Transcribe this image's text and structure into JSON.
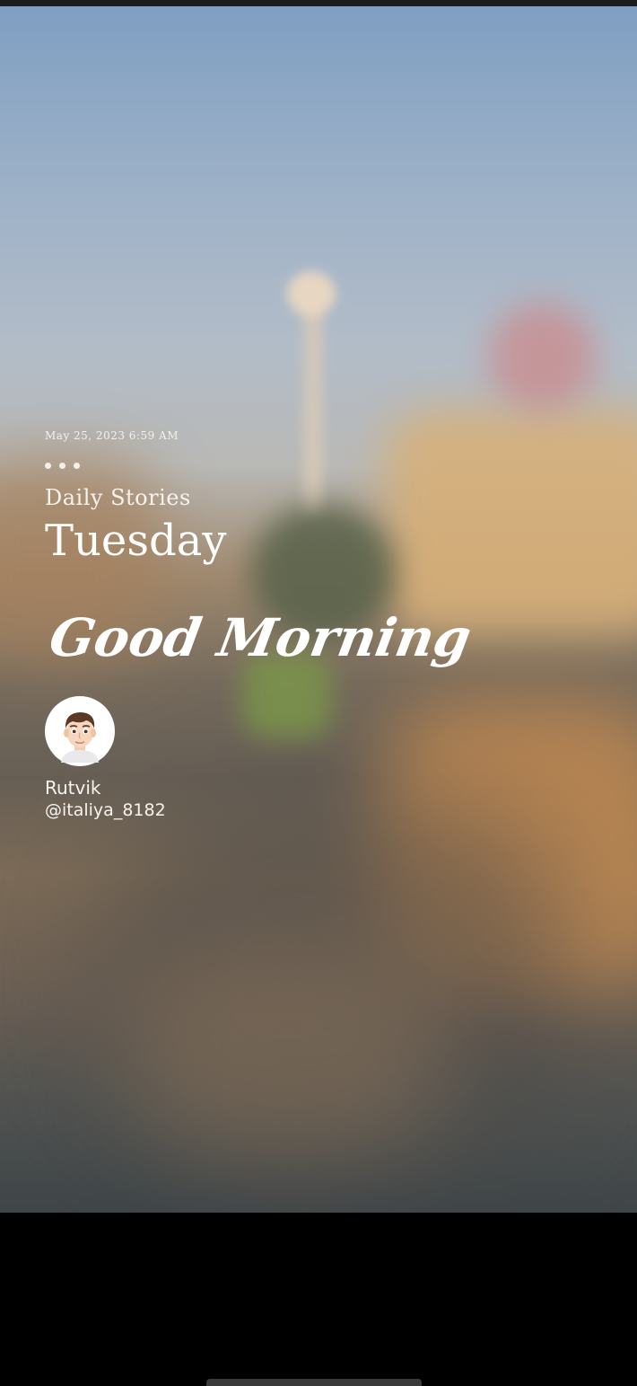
{
  "story": {
    "timestamp": "May 25, 2023 6:59 AM",
    "series_title": "Daily Stories",
    "day_name": "Tuesday",
    "greeting": "Good Morning",
    "author": {
      "avatar_icon": "memoji-avatar-icon",
      "name": "Rutvik",
      "handle": "@italiya_8182"
    },
    "progress_dots": 3
  },
  "colors": {
    "text": "#ffffff",
    "screen_background": "#000000",
    "avatar_ring": "#ffffff"
  }
}
